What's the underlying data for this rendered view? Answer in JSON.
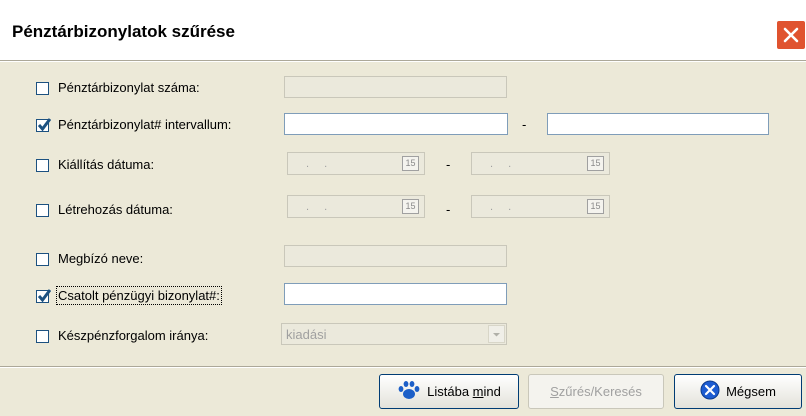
{
  "window": {
    "title": "Pénztárbizonylatok szűrése"
  },
  "filters": {
    "receipt_number": {
      "label": "Pénztárbizonylat száma:",
      "checked": false
    },
    "receipt_interval": {
      "label": "Pénztárbizonylat# intervallum:",
      "checked": true,
      "separator": "-"
    },
    "issue_date": {
      "label": "Kiállítás dátuma:",
      "checked": false,
      "placeholder": ". .",
      "separator": "-",
      "calendar_day": "15"
    },
    "create_date": {
      "label": "Létrehozás dátuma:",
      "checked": false,
      "placeholder": ". .",
      "separator": "-",
      "calendar_day": "15"
    },
    "principal_name": {
      "label": "Megbízó neve:",
      "checked": false
    },
    "attached_receipt": {
      "label": "Csatolt pénzügyi bizonylat#:",
      "checked": true
    },
    "cash_direction": {
      "label": "Készpénzforgalom iránya:",
      "checked": false,
      "selected": "kiadási"
    }
  },
  "buttons": {
    "list_all": {
      "pre": "Listába ",
      "accel": "m",
      "post": "ind"
    },
    "filter": {
      "accel": "S",
      "post": "zűrés/Keresés"
    },
    "cancel": {
      "label": "Mégsem"
    }
  },
  "colors": {
    "checkmark": "#1c5180",
    "cancel_icon": "#1d5cd1",
    "paw_icon": "#1c5fc8",
    "close": "#e0532f"
  }
}
